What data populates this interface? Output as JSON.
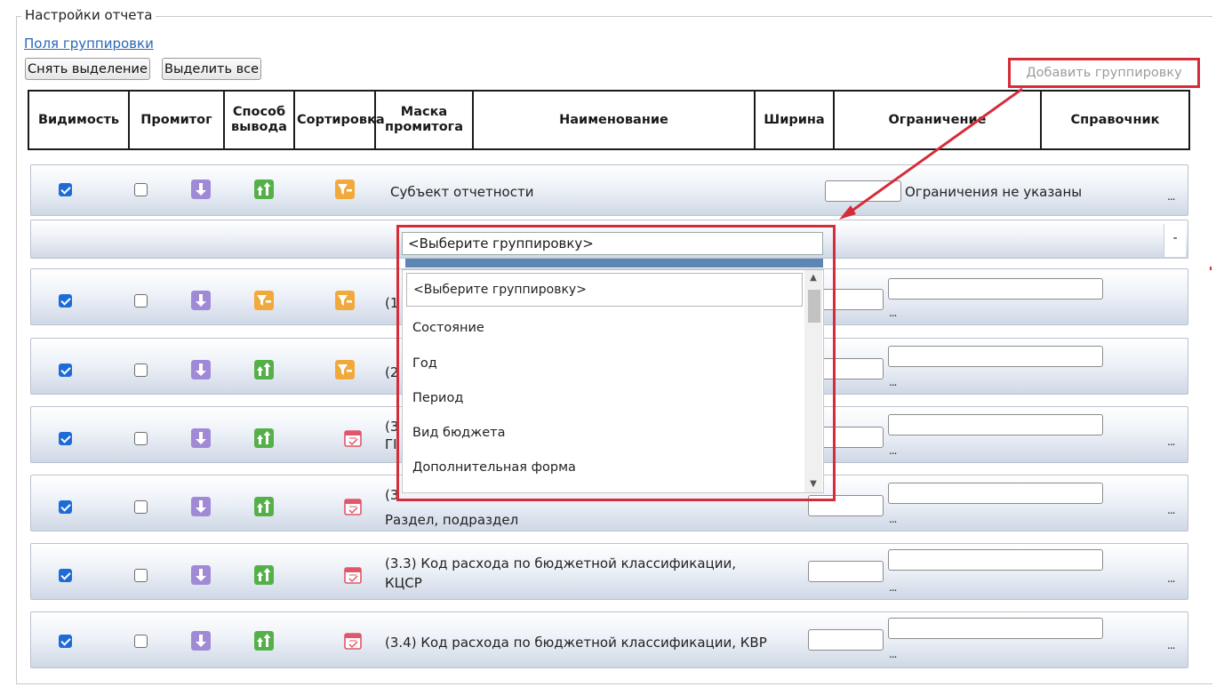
{
  "panel": {
    "legend": "Настройки отчета",
    "grouping_link": "Поля группировки",
    "deselect_label": "Снять выделение",
    "select_all_label": "Выделить все",
    "add_grouping_label": "Добавить группировку"
  },
  "columns": [
    "Видимость",
    "Промитог",
    "Способ вывода",
    "Сортировка",
    "Маска промитога",
    "Наименование",
    "Ширина",
    "Ограничение",
    "Справочник"
  ],
  "rows": [
    {
      "visible": true,
      "subtotal": false,
      "output": "down-arrow-icon",
      "sort": "sort-asc-icon",
      "mask": "filter-icon",
      "name": "Субъект отчетности",
      "restriction_text": "Ограничения не указаны",
      "ref_button": "..."
    },
    {
      "visible": true,
      "subtotal": false,
      "output": "down-arrow-icon",
      "sort": "filter-icon",
      "mask": "filter-icon",
      "name": "(1",
      "restriction_text": "",
      "ref_button": ""
    },
    {
      "visible": true,
      "subtotal": false,
      "output": "down-arrow-icon",
      "sort": "sort-asc-icon",
      "mask": "filter-icon",
      "name": "(2",
      "restriction_text": "",
      "ref_button": ""
    },
    {
      "visible": true,
      "subtotal": false,
      "output": "down-arrow-icon",
      "sort": "sort-asc-icon",
      "mask": "calendar-icon",
      "name": "(3",
      "name_line2": "ГІ",
      "restriction_text": "",
      "ref_button": "..."
    },
    {
      "visible": true,
      "subtotal": false,
      "output": "down-arrow-icon",
      "sort": "sort-asc-icon",
      "mask": "calendar-icon",
      "name": "(3",
      "name_line2": "Раздел, подраздел",
      "restriction_text": "",
      "ref_button": "..."
    },
    {
      "visible": true,
      "subtotal": false,
      "output": "down-arrow-icon",
      "sort": "sort-asc-icon",
      "mask": "calendar-icon",
      "name": "(3.3) Код расхода по бюджетной классификации,",
      "name_line2": "КЦСР",
      "restriction_text": "",
      "ref_button": "..."
    },
    {
      "visible": true,
      "subtotal": false,
      "output": "down-arrow-icon",
      "sort": "sort-asc-icon",
      "mask": "calendar-icon",
      "name": "(3.4) Код расхода по бюджетной классификации, КВР",
      "restriction_text": "",
      "ref_button": "..."
    }
  ],
  "new_group_row": {
    "minus_label": "-",
    "select_value": "<Выберите группировку>",
    "options": [
      "<Выберите группировку>",
      "Состояние",
      "Год",
      "Период",
      "Вид бюджета",
      "Дополнительная форма"
    ]
  },
  "small_dots": "...",
  "colors": {
    "accent_red": "#d62c3a",
    "link_blue": "#2a66b8",
    "checkbox_blue": "#1e6bd6",
    "icon_purple": "#a08ad6",
    "icon_green": "#55b04a",
    "icon_orange": "#f2a93b"
  }
}
